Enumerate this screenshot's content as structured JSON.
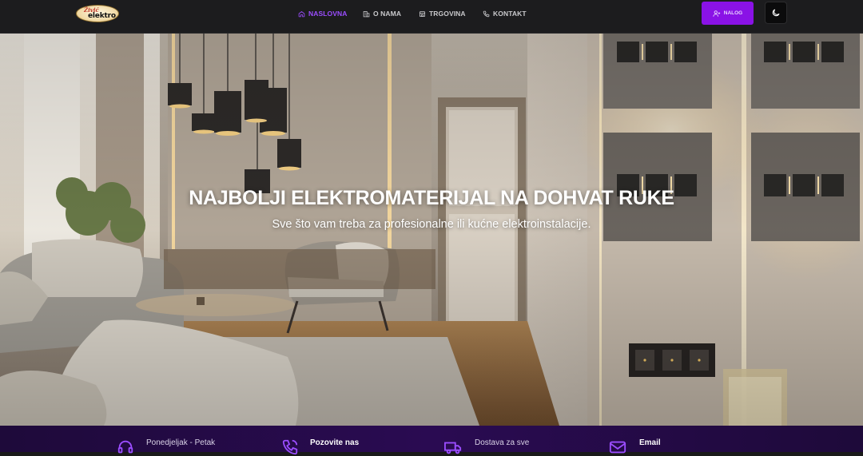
{
  "logo": {
    "line1": "Živić",
    "line2": "elektro"
  },
  "nav": {
    "items": [
      {
        "label": "NASLOVNA",
        "active": true
      },
      {
        "label": "O NAMA",
        "active": false
      },
      {
        "label": "TRGOVINA",
        "active": false
      },
      {
        "label": "KONTAKT",
        "active": false
      }
    ],
    "login_label": "NALOG"
  },
  "hero": {
    "title": "NAJBOLJI ELEKTROMATERIJAL NA DOHVAT RUKE",
    "subtitle": "Sve što vam treba za profesionalne ili kućne elektroinstalacije."
  },
  "info": {
    "hours_label": "Ponedjeljak - Petak",
    "phone_label": "Pozovite nas",
    "delivery_label": "Dostava za sve",
    "email_label": "Email"
  },
  "colors": {
    "accent": "#8a12e6",
    "active_link": "#9b4dff",
    "navbar_bg": "#1c1c1e",
    "strip_bg": "#2a0b52"
  }
}
